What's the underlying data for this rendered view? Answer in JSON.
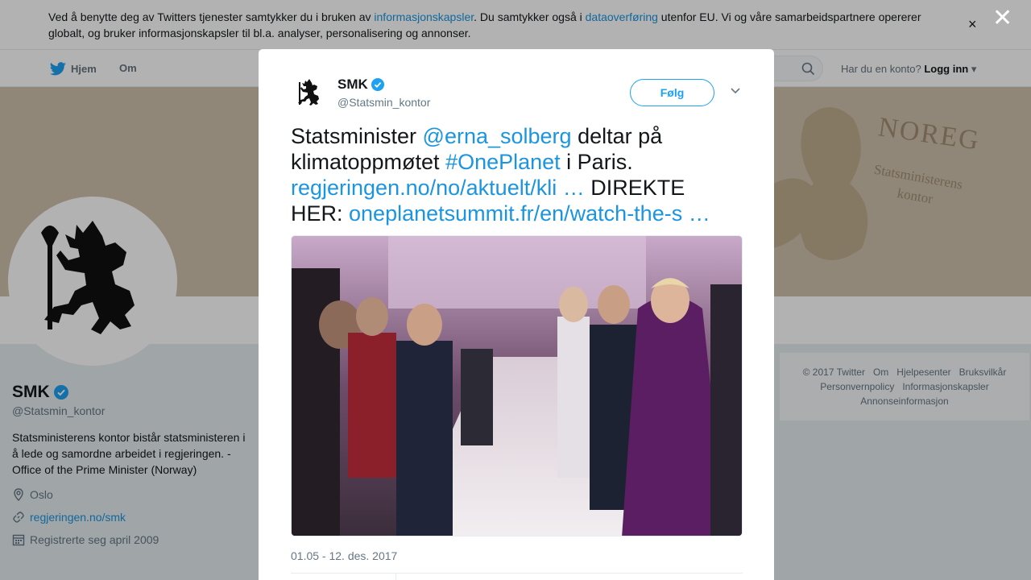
{
  "cookie_bar": {
    "text_1": "Ved å benytte deg av Twitters tjenester samtykker du i bruken av ",
    "link_1": "informasjonskapsler",
    "text_2": ". Du samtykker også i ",
    "link_2": "dataoverføring",
    "text_3": " utenfor EU. Vi og våre samarbeidspartnere opererer globalt, og bruker informasjonskapsler til bl.a. analyser, personalisering og annonser.",
    "close": "×"
  },
  "nav": {
    "home": "Hjem",
    "about": "Om",
    "login_prompt": "Har du en konto?",
    "login": "Logg inn"
  },
  "banner": {
    "line_1": "NOREG",
    "line_2": "Statsministerens kontor"
  },
  "profile": {
    "name": "SMK",
    "handle": "@Statsmin_kontor",
    "bio": "Statsministerens kontor bistår statsministeren i å lede og samordne arbeidet i regjeringen. - Office of the Prime Minister (Norway)",
    "location": "Oslo",
    "url": "regjeringen.no/smk",
    "joined": "Registrerte seg april 2009"
  },
  "footer": {
    "links": [
      "© 2017 Twitter",
      "Om",
      "Hjelpesenter",
      "Bruksvilkår",
      "Personvernpolicy",
      "Informasjonskapsler",
      "Annonseinformasjon"
    ]
  },
  "overlay": {
    "close": "✕"
  },
  "tweet": {
    "author": "SMK",
    "handle": "@Statsmin_kontor",
    "follow": "Følg",
    "text_1": "Statsminister ",
    "mention": "@erna_solberg",
    "text_2": " deltar på klimatoppmøtet ",
    "hashtag": "#OnePlanet",
    "text_3": " i Paris. ",
    "link_1": "regjeringen.no/no/aktuelt/kli …",
    "text_4": " DIREKTE HER: ",
    "link_2": "oneplanetsummit.fr/en/watch-the-s …",
    "date": "01.05 - 12. des. 2017"
  },
  "colors": {
    "accent": "#1da1f2",
    "link": "#1b95e0",
    "muted": "#657786",
    "verified": "#1da1f2"
  }
}
